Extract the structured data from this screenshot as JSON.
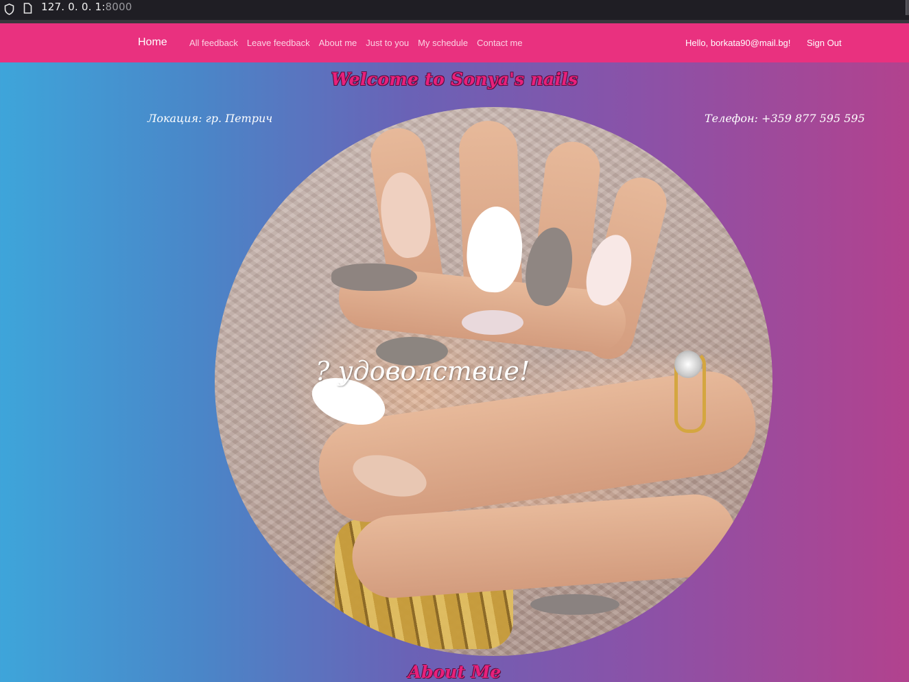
{
  "browser": {
    "url_host": "127. 0. 0. 1:",
    "url_port": "8000"
  },
  "nav": {
    "brand": "Home",
    "links": [
      {
        "label": "All feedback"
      },
      {
        "label": "Leave feedback"
      },
      {
        "label": "About me"
      },
      {
        "label": "Just to you"
      },
      {
        "label": "My schedule"
      },
      {
        "label": "Contact me"
      }
    ],
    "greeting": "Hello, borkata90@mail.bg!",
    "sign_out": "Sign Out"
  },
  "hero": {
    "title": "Welcome to Sonya's nails",
    "location": "Локация: гр. Петрич",
    "phone": "Телефон: +359 877 595 595",
    "slogan": "? удоволствие!"
  },
  "sections": {
    "about_heading": "About Me"
  },
  "colors": {
    "navbar": "#e9317f",
    "title": "#e8207a"
  },
  "icons": {
    "shield": "shield-icon",
    "page": "page-icon"
  }
}
